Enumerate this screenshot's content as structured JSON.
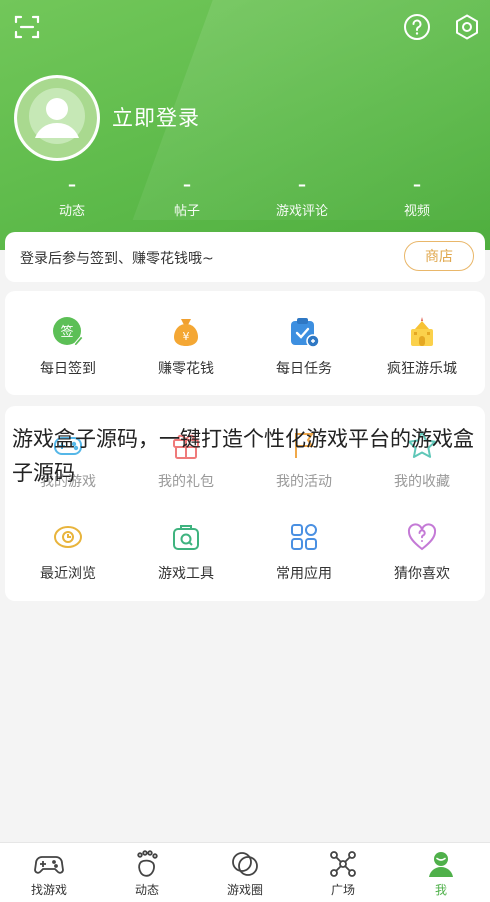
{
  "header": {
    "login_text": "立即登录",
    "stats": [
      {
        "value": "–",
        "label": "动态"
      },
      {
        "value": "–",
        "label": "帖子"
      },
      {
        "value": "–",
        "label": "游戏评论"
      },
      {
        "value": "–",
        "label": "视频"
      }
    ]
  },
  "notice": {
    "text": "登录后参与签到、赚零花钱哦~",
    "shop_label": "商店"
  },
  "menu1": [
    {
      "label": "每日签到",
      "icon": "checkin-icon"
    },
    {
      "label": "赚零花钱",
      "icon": "money-bag-icon"
    },
    {
      "label": "每日任务",
      "icon": "task-icon"
    },
    {
      "label": "疯狂游乐城",
      "icon": "castle-icon"
    }
  ],
  "menu2_row1": [
    {
      "label": "我的游戏",
      "icon": "controller-icon"
    },
    {
      "label": "我的礼包",
      "icon": "gift-icon"
    },
    {
      "label": "我的活动",
      "icon": "flag-icon"
    },
    {
      "label": "我的收藏",
      "icon": "star-icon"
    }
  ],
  "menu2_row2": [
    {
      "label": "最近浏览",
      "icon": "eye-icon"
    },
    {
      "label": "游戏工具",
      "icon": "toolbox-icon"
    },
    {
      "label": "常用应用",
      "icon": "apps-icon"
    },
    {
      "label": "猜你喜欢",
      "icon": "heart-question-icon"
    }
  ],
  "overlay_text": "游戏盒子源码，一键打造个性化游戏平台的游戏盒子源码",
  "tabbar": [
    {
      "label": "找游戏",
      "icon": "gamepad-icon"
    },
    {
      "label": "动态",
      "icon": "footprint-icon"
    },
    {
      "label": "游戏圈",
      "icon": "circles-icon"
    },
    {
      "label": "广场",
      "icon": "network-icon"
    },
    {
      "label": "我",
      "icon": "person-icon"
    }
  ],
  "colors": {
    "brand_green": "#5dba4a",
    "shop_orange": "#e0a84e",
    "active_tab": "#4fb04a"
  }
}
